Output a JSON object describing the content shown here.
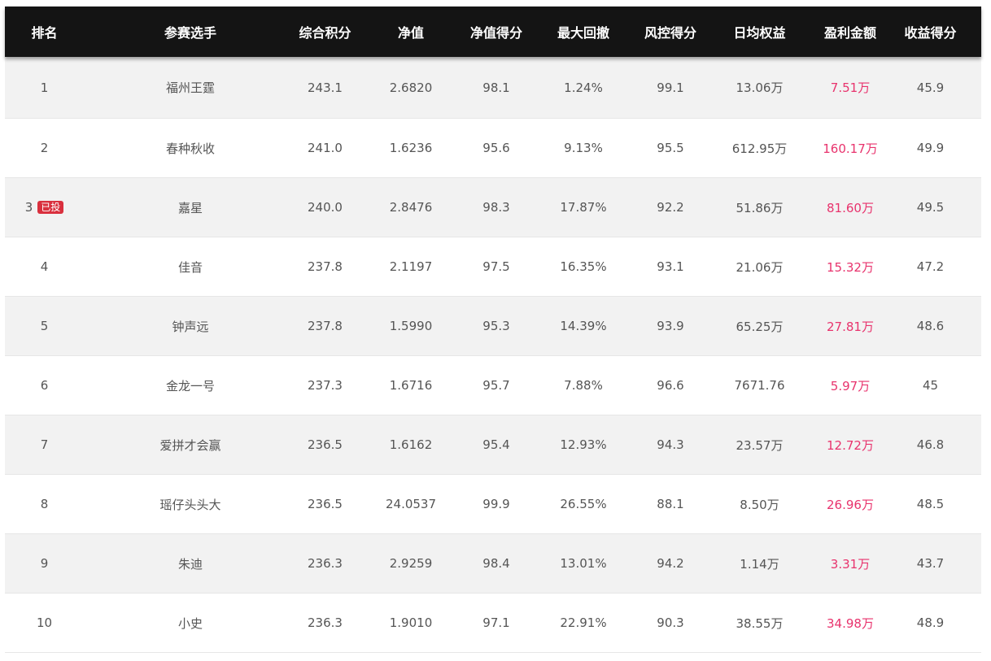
{
  "headers": [
    "排名",
    "参赛选手",
    "综合积分",
    "净值",
    "净值得分",
    "最大回撤",
    "风控得分",
    "日均权益",
    "盈利金额",
    "收益得分"
  ],
  "rows": [
    {
      "rank": "1",
      "badge": "",
      "name": "福州王霆",
      "score": "243.1",
      "nav": "2.6820",
      "nav_score": "98.1",
      "drawdown": "1.24%",
      "risk_score": "99.1",
      "avg_equity": "13.06万",
      "profit": "7.51万",
      "return_score": "45.9"
    },
    {
      "rank": "2",
      "badge": "",
      "name": "春种秋收",
      "score": "241.0",
      "nav": "1.6236",
      "nav_score": "95.6",
      "drawdown": "9.13%",
      "risk_score": "95.5",
      "avg_equity": "612.95万",
      "profit": "160.17万",
      "return_score": "49.9"
    },
    {
      "rank": "3",
      "badge": "已投",
      "name": "嘉星",
      "score": "240.0",
      "nav": "2.8476",
      "nav_score": "98.3",
      "drawdown": "17.87%",
      "risk_score": "92.2",
      "avg_equity": "51.86万",
      "profit": "81.60万",
      "return_score": "49.5"
    },
    {
      "rank": "4",
      "badge": "",
      "name": "佳音",
      "score": "237.8",
      "nav": "2.1197",
      "nav_score": "97.5",
      "drawdown": "16.35%",
      "risk_score": "93.1",
      "avg_equity": "21.06万",
      "profit": "15.32万",
      "return_score": "47.2"
    },
    {
      "rank": "5",
      "badge": "",
      "name": "钟声远",
      "score": "237.8",
      "nav": "1.5990",
      "nav_score": "95.3",
      "drawdown": "14.39%",
      "risk_score": "93.9",
      "avg_equity": "65.25万",
      "profit": "27.81万",
      "return_score": "48.6"
    },
    {
      "rank": "6",
      "badge": "",
      "name": "金龙一号",
      "score": "237.3",
      "nav": "1.6716",
      "nav_score": "95.7",
      "drawdown": "7.88%",
      "risk_score": "96.6",
      "avg_equity": "7671.76",
      "profit": "5.97万",
      "return_score": "45"
    },
    {
      "rank": "7",
      "badge": "",
      "name": "爱拼才会赢",
      "score": "236.5",
      "nav": "1.6162",
      "nav_score": "95.4",
      "drawdown": "12.93%",
      "risk_score": "94.3",
      "avg_equity": "23.57万",
      "profit": "12.72万",
      "return_score": "46.8"
    },
    {
      "rank": "8",
      "badge": "",
      "name": "瑶仔头头大",
      "score": "236.5",
      "nav": "24.0537",
      "nav_score": "99.9",
      "drawdown": "26.55%",
      "risk_score": "88.1",
      "avg_equity": "8.50万",
      "profit": "26.96万",
      "return_score": "48.5"
    },
    {
      "rank": "9",
      "badge": "",
      "name": "朱迪",
      "score": "236.3",
      "nav": "2.9259",
      "nav_score": "98.4",
      "drawdown": "13.01%",
      "risk_score": "94.2",
      "avg_equity": "1.14万",
      "profit": "3.31万",
      "return_score": "43.7"
    },
    {
      "rank": "10",
      "badge": "",
      "name": "小史",
      "score": "236.3",
      "nav": "1.9010",
      "nav_score": "97.1",
      "drawdown": "22.91%",
      "risk_score": "90.3",
      "avg_equity": "38.55万",
      "profit": "34.98万",
      "return_score": "48.9"
    }
  ],
  "colors": {
    "header_bg": "#141414",
    "profit": "#e8336d",
    "badge": "#d9303e",
    "stripe": "#f2f2f2"
  }
}
